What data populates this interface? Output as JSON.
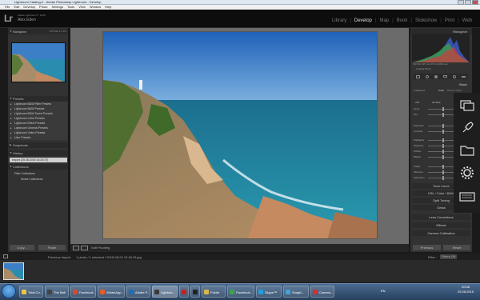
{
  "window": {
    "title": "Lightroom Catalog-2 - Adobe Photoshop Lightroom - Develop"
  },
  "menu": [
    "File",
    "Edit",
    "Develop",
    "Photo",
    "Settings",
    "Tools",
    "View",
    "Window",
    "Help"
  ],
  "identity": {
    "logo": "Lr",
    "subtitle": "Adobe Lightroom 5 · 2015",
    "name": "Alex Eden"
  },
  "modules": [
    {
      "label": "Library",
      "active": false
    },
    {
      "label": "Develop",
      "active": true
    },
    {
      "label": "Map",
      "active": false
    },
    {
      "label": "Book",
      "active": false
    },
    {
      "label": "Slideshow",
      "active": false
    },
    {
      "label": "Print",
      "active": false
    },
    {
      "label": "Web",
      "active": false
    }
  ],
  "left_panel": {
    "navigator": {
      "title": "Navigator",
      "zoom": "FIT  FILL  1:1  3:1"
    },
    "presets": {
      "title": "Presets",
      "items": [
        "Lightroom B&W Filter Presets",
        "Lightroom B&W Presets",
        "Lightroom B&W Toned Presets",
        "Lightroom Color Presets",
        "Lightroom Effect Presets",
        "Lightroom General Presets",
        "Lightroom Video Presets",
        "User Presets"
      ]
    },
    "snapshots": {
      "title": "Snapshots"
    },
    "history": {
      "title": "History",
      "item": "Import (25.08.2015 15:20:37)"
    },
    "collections": {
      "title": "Collections",
      "items": [
        "Filter Collections",
        "Smart Collections"
      ]
    },
    "copy_label": "Copy...",
    "paste_label": "Paste"
  },
  "toolbar": {
    "soft_proofing": "Soft Proofing"
  },
  "right_panel": {
    "histogram_title": "Histogram",
    "histogram_info": "ISO 64   4.35 mm   f/2.6   1/1600 sec",
    "original_photo": "Original Photo",
    "basic_title": "Basic",
    "treatment_label": "Treatment:",
    "treatment_color": "Color",
    "treatment_bw": "Black & White",
    "wb_label": "WB :",
    "wb_value": "As Shot",
    "sliders": [
      "Temp",
      "Tint",
      "Exposure",
      "Contrast",
      "Highlights",
      "Shadows",
      "Whites",
      "Blacks",
      "Clarity",
      "Vibrance",
      "Saturation"
    ],
    "sections": [
      "Tone Curve",
      "HSL / Color / B&W",
      "Split Toning",
      "Detail",
      "Lens Corrections",
      "Effects",
      "Camera Calibration"
    ],
    "previous_label": "Previous",
    "reset_label": "Reset"
  },
  "filmbar": {
    "prev_import": "Previous Import",
    "info": "1 photo / 1 selected / 2015-08-24 13.46.29.jpg",
    "filter_label": "Filter :",
    "filter_value": "Filters Off"
  },
  "taskbar": {
    "items": [
      {
        "label": "Total Co...",
        "color": "#e8c547"
      },
      {
        "label": "The Bat!",
        "color": "#444444"
      },
      {
        "label": "Facebook...",
        "color": "#d94a2a"
      },
      {
        "label": "WhatsApp...",
        "color": "#e55b2b"
      },
      {
        "label": "Adobe P...",
        "color": "#1d6fb8"
      },
      {
        "label": "Lightroo...",
        "color": "#3a3a3a"
      },
      {
        "label": "",
        "color": "#c32222"
      },
      {
        "label": "",
        "color": "#222222"
      },
      {
        "label": "Folder",
        "color": "#d8b64a"
      },
      {
        "label": "Facebook...",
        "color": "#3fa34d"
      },
      {
        "label": "Skype™",
        "color": "#1d9fe0"
      },
      {
        "label": "SnagIt...",
        "color": "#46a1d6"
      },
      {
        "label": "Camera...",
        "color": "#c33"
      }
    ],
    "lang": "EN",
    "time": "20:58",
    "date": "25.08.2015"
  }
}
